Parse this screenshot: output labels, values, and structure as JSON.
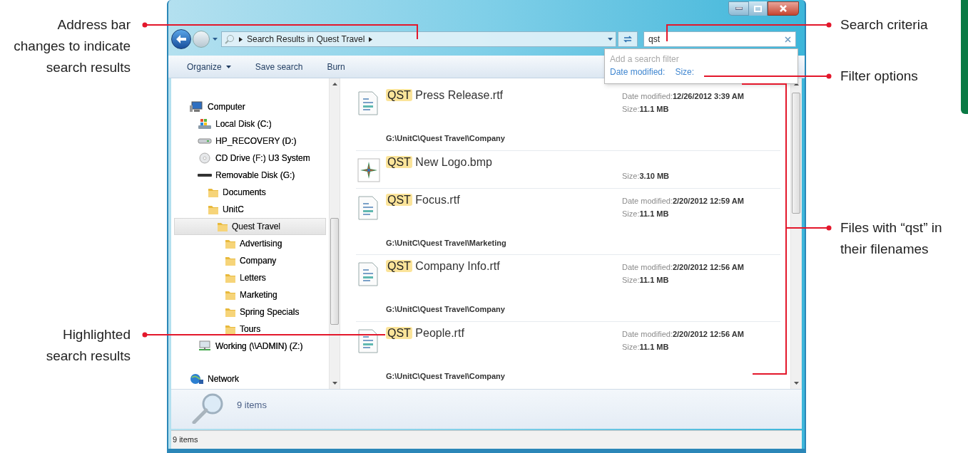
{
  "callouts": [
    {
      "text": "Address bar\nchanges to indicate\nsearch results"
    },
    {
      "text": "Highlighted\nsearch results"
    },
    {
      "text": "Search criteria"
    },
    {
      "text": "Filter options"
    },
    {
      "text": "Files with “qst” in\ntheir filenames"
    }
  ],
  "window": {
    "address": {
      "crumb": "Search Results in Quest Travel"
    },
    "search": {
      "value": "qst",
      "dropdown": {
        "heading": "Add a search filter",
        "filters": [
          "Date modified:",
          "Size:"
        ]
      }
    },
    "toolbar": [
      {
        "label": "Organize",
        "menu": true
      },
      {
        "label": "Save search",
        "menu": false
      },
      {
        "label": "Burn",
        "menu": false
      }
    ],
    "nav": [
      {
        "label": "Computer",
        "kind": "computer",
        "selected": false,
        "children": [
          {
            "label": "Local Disk (C:)",
            "kind": "system-disk",
            "selected": false
          },
          {
            "label": "HP_RECOVERY (D:)",
            "kind": "drive",
            "selected": false
          },
          {
            "label": "CD Drive (F:) U3 System",
            "kind": "cd",
            "selected": false
          },
          {
            "label": "Removable Disk (G:)",
            "kind": "removable",
            "selected": false,
            "children": [
              {
                "label": "Documents",
                "kind": "folder",
                "selected": false
              },
              {
                "label": "UnitC",
                "kind": "folder",
                "selected": false,
                "children": [
                  {
                    "label": "Quest Travel",
                    "kind": "folder",
                    "selected": true,
                    "children": [
                      {
                        "label": "Advertising",
                        "kind": "folder",
                        "selected": false
                      },
                      {
                        "label": "Company",
                        "kind": "folder",
                        "selected": false
                      },
                      {
                        "label": "Letters",
                        "kind": "folder",
                        "selected": false
                      },
                      {
                        "label": "Marketing",
                        "kind": "folder",
                        "selected": false
                      },
                      {
                        "label": "Spring Specials",
                        "kind": "folder",
                        "selected": false
                      },
                      {
                        "label": "Tours",
                        "kind": "folder",
                        "selected": false
                      }
                    ]
                  }
                ]
              }
            ]
          },
          {
            "label": "Working (\\\\ADMIN) (Z:)",
            "kind": "network-drive",
            "selected": false
          }
        ]
      },
      {
        "label": "Network",
        "kind": "network",
        "selected": false
      }
    ],
    "files": [
      {
        "kind": "document",
        "match": "QST",
        "name": "Press Release.rtf",
        "date_label": "Date modified:",
        "date": "12/26/2012 3:39 AM",
        "size_label": "Size:",
        "size": "11.1 MB",
        "path": "G:\\UnitC\\Quest Travel\\Company"
      },
      {
        "kind": "image",
        "match": "QST",
        "name": "New Logo.bmp",
        "size_label": "Size:",
        "size": "3.10 MB"
      },
      {
        "kind": "document",
        "match": "QST",
        "name": "Focus.rtf",
        "date_label": "Date modified:",
        "date": "2/20/2012 12:59 AM",
        "size_label": "Size:",
        "size": "11.1 MB",
        "path": "G:\\UnitC\\Quest Travel\\Marketing"
      },
      {
        "kind": "document",
        "match": "QST",
        "name": "Company Info.rtf",
        "date_label": "Date modified:",
        "date": "2/20/2012 12:56 AM",
        "size_label": "Size:",
        "size": "11.1 MB",
        "path": "G:\\UnitC\\Quest Travel\\Company"
      },
      {
        "kind": "document",
        "match": "QST",
        "name": "People.rtf",
        "date_label": "Date modified:",
        "date": "2/20/2012 12:56 AM",
        "size_label": "Size:",
        "size": "11.1 MB",
        "path": "G:\\UnitC\\Quest Travel\\Company"
      }
    ],
    "details": {
      "count": "9 items"
    },
    "status": "9 items"
  }
}
